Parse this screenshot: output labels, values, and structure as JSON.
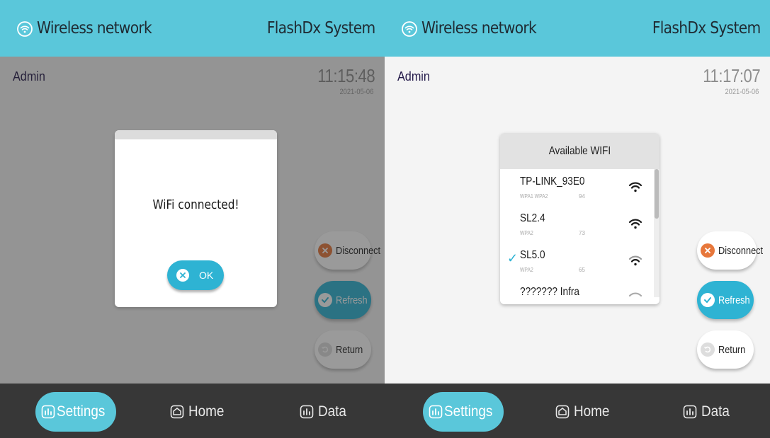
{
  "colors": {
    "accent": "#5ac7da",
    "button_blue": "#2eb3d3",
    "disconnect_orange": "#e7773b",
    "bottom_bar": "#373737"
  },
  "left": {
    "header": {
      "title": "Wireless network",
      "system": "FlashDx System"
    },
    "user": "Admin",
    "time": "11:15:48",
    "date": "2021-05-06",
    "dialog": {
      "message": "WiFi connected!",
      "ok_label": "OK"
    },
    "buttons": {
      "disconnect": "Disconnect",
      "refresh": "Refresh",
      "return": "Return"
    },
    "nav": {
      "settings": "Settings",
      "home": "Home",
      "data": "Data"
    }
  },
  "right": {
    "header": {
      "title": "Wireless network",
      "system": "FlashDx System"
    },
    "user": "Admin",
    "time": "11:17:07",
    "date": "2021-05-06",
    "wifi_panel": {
      "title": "Available WIFI",
      "networks": [
        {
          "name": "TP-LINK_93E0",
          "security": "WPA1 WPA2",
          "signal": "94",
          "connected": false
        },
        {
          "name": "SL2.4",
          "security": "WPA2",
          "signal": "73",
          "connected": false
        },
        {
          "name": "SL5.0",
          "security": "WPA2",
          "signal": "65",
          "connected": true,
          "check": "✓"
        },
        {
          "name": "??????? Infra",
          "security": "",
          "signal": "",
          "connected": false
        }
      ]
    },
    "buttons": {
      "disconnect": "Disconnect",
      "refresh": "Refresh",
      "return": "Return"
    },
    "nav": {
      "settings": "Settings",
      "home": "Home",
      "data": "Data"
    }
  }
}
